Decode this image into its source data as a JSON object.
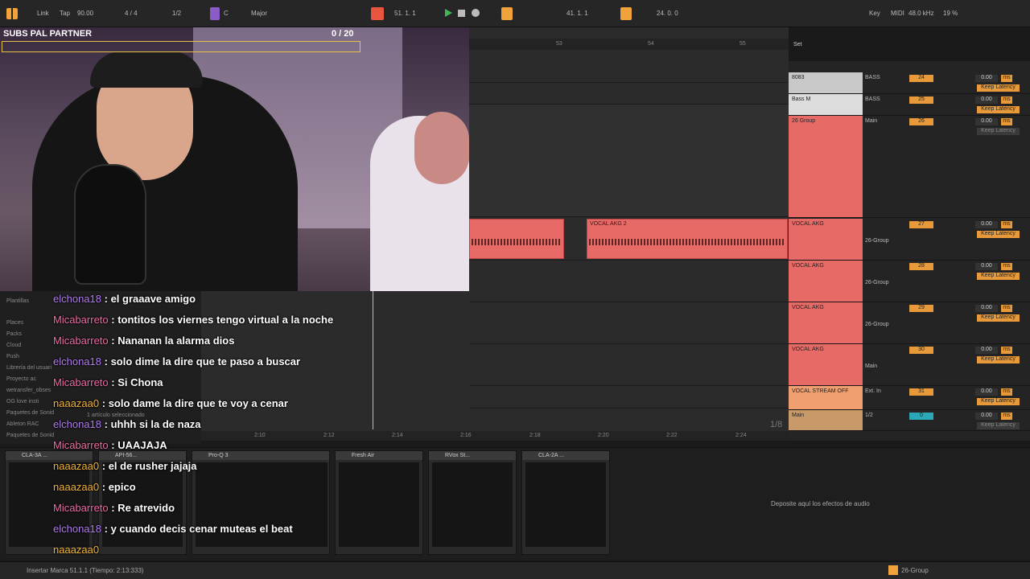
{
  "transport": {
    "link": "Link",
    "tap": "Tap",
    "tempo": "90.00",
    "time_sig": "4 / 4",
    "quantize": "1/2",
    "scale_key": "C",
    "scale_mode": "Major",
    "position": "51.   1.   1",
    "loop_start": "41.   1.   1",
    "loop_length": "24.   0.   0",
    "key_label": "Key",
    "midi_label": "MIDI",
    "sample_rate": "48.0 kHz",
    "cpu": "19 %"
  },
  "webcam": {
    "overlay_title": "SUBS PAL PARTNER",
    "overlay_count": "0  / 20"
  },
  "arrangement": {
    "ruler_marks": [
      "53",
      "54",
      "55"
    ],
    "set_label": "Set",
    "clip_name": "VOCAL AKG 2",
    "bottom_ruler": [
      "2:10",
      "2:12",
      "2:14",
      "2:16",
      "2:18",
      "2:20",
      "2:22",
      "2:24"
    ],
    "page": "1/8"
  },
  "tracks": [
    {
      "name": "8083",
      "io": "BASS",
      "vol": "24",
      "pan": "0.00",
      "ms": "ms",
      "latency": "Keep Latency",
      "color": "#c8c8c8"
    },
    {
      "name": "Bass M",
      "io": "BASS",
      "vol": "25",
      "pan": "0.00",
      "ms": "ms",
      "latency": "Keep Latency",
      "color": "#dcdcdc"
    },
    {
      "name": "26 Group",
      "io": "Main",
      "vol": "26",
      "pan": "0.00",
      "ms": "ms",
      "latency": "Keep Latency",
      "color": "#e86a66"
    },
    {
      "name": "VOCAL AKG",
      "io": "26-Group",
      "vol": "27",
      "pan": "0.00",
      "ms": "ms",
      "latency": "Keep Latency",
      "color": "#e86a66"
    },
    {
      "name": "VOCAL AKG",
      "io": "26-Group",
      "vol": "28",
      "pan": "0.00",
      "ms": "ms",
      "latency": "Keep Latency",
      "color": "#e86a66"
    },
    {
      "name": "VOCAL AKG",
      "io": "26-Group",
      "vol": "29",
      "pan": "0.00",
      "ms": "ms",
      "latency": "Keep Latency",
      "color": "#e86a66"
    },
    {
      "name": "VOCAL AKG",
      "io": "Main",
      "vol": "30",
      "pan": "0.00",
      "ms": "ms",
      "latency": "Keep Latency",
      "color": "#e86a66"
    },
    {
      "name": "VOCAL STREAM OFF",
      "io": "Ext. In",
      "vol": "31",
      "pan": "0.00",
      "ms": "ms",
      "latency": "Keep Latency",
      "color": "#f0a070"
    },
    {
      "name": "Main",
      "io": "1/2",
      "vol": "0",
      "pan": "0.00",
      "ms": "ms",
      "latency": "Keep Latency",
      "color": "#c89a6a"
    }
  ],
  "browser": {
    "items": [
      "Plantillas",
      "Places",
      "Packs",
      "Cloud",
      "Push",
      "Librería del usuari",
      "Proyecto ac",
      "wetransfer_obses",
      "OG love insti",
      "Paquetes de Sonid",
      "Ableton RAC",
      "Paquetes de Sonid"
    ],
    "status": "1 artículo seleccionado"
  },
  "chat": [
    {
      "user": "elchona18",
      "cls": "u-elchona",
      "msg": "el graaave amigo"
    },
    {
      "user": "Micabarreto",
      "cls": "u-mica",
      "msg": "tontitos los viernes tengo virtual a la noche"
    },
    {
      "user": "Micabarreto",
      "cls": "u-mica",
      "msg": "Nananan la alarma dios"
    },
    {
      "user": "elchona18",
      "cls": "u-elchona",
      "msg": "solo dime la dire que te paso a buscar"
    },
    {
      "user": "Micabarreto",
      "cls": "u-mica",
      "msg": "Si Chona"
    },
    {
      "user": "naaazaa0",
      "cls": "u-naaa",
      "msg": "solo dame la dire que te voy a cenar"
    },
    {
      "user": "elchona18",
      "cls": "u-elchona",
      "msg": "uhhh si la de naza"
    },
    {
      "user": "Micabarreto",
      "cls": "u-mica",
      "msg": "UAAJAJA"
    },
    {
      "user": "naaazaa0",
      "cls": "u-naaa",
      "msg": "el de rusher jajaja"
    },
    {
      "user": "naaazaa0",
      "cls": "u-naaa",
      "msg": "epico"
    },
    {
      "user": "Micabarreto",
      "cls": "u-mica",
      "msg": "Re atrevido"
    },
    {
      "user": "elchona18",
      "cls": "u-elchona",
      "msg": "y cuando decis cenar muteas el beat"
    },
    {
      "user": "naaazaa0",
      "cls": "u-naaa",
      "msg": ""
    }
  ],
  "devices": [
    {
      "name": "CLA-3A ..."
    },
    {
      "name": "API-56..."
    },
    {
      "name": "Pro-Q 3"
    },
    {
      "name": "Fresh Air"
    },
    {
      "name": "RVox St..."
    },
    {
      "name": "CLA-2A ..."
    }
  ],
  "devices_drop": "Deposite aquí los efectos de audio",
  "status": {
    "text": "Insertar Marca 51.1.1 (Tiempo: 2:13:333)",
    "group": "26-Group"
  }
}
